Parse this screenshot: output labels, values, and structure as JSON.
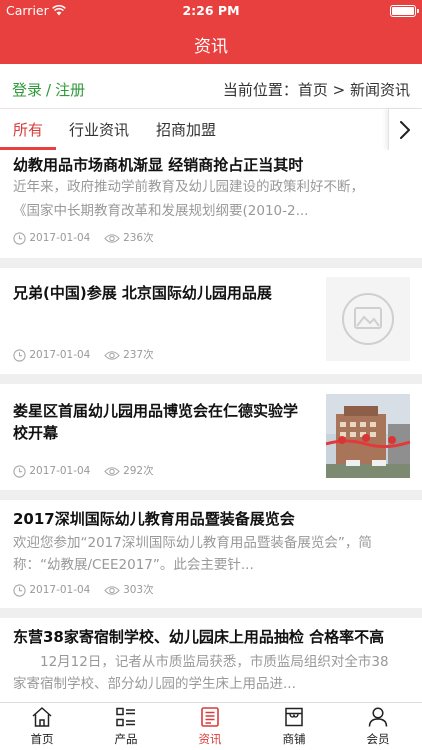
{
  "status": {
    "carrier": "Carrier",
    "time": "2:26 PM"
  },
  "nav": {
    "title": "资讯"
  },
  "subbar": {
    "login": "登录",
    "divider": "/",
    "register": "注册",
    "location": "当前位置：首页 > 新闻资讯"
  },
  "tabs": [
    {
      "label": "所有",
      "active": true
    },
    {
      "label": "行业资讯",
      "active": false
    },
    {
      "label": "招商加盟",
      "active": false
    }
  ],
  "articles": [
    {
      "title": "幼教用品市场商机渐显 经销商抢占正当其时",
      "desc1": "近年来，政府推动学前教育及幼儿园建设的政策利好不断，",
      "desc2": "《国家中长期教育改革和发展规划纲要(2010-2...",
      "date": "2017-01-04",
      "views": "236次",
      "thumb": "none"
    },
    {
      "title": "兄弟(中国)参展 北京国际幼儿园用品展",
      "date": "2017-01-04",
      "views": "237次",
      "thumb": "placeholder-image-icon"
    },
    {
      "title1": "娄星区首届幼儿园用品博览会在仁德实验学",
      "title2": "校开幕",
      "date": "2017-01-04",
      "views": "292次",
      "thumb": "building-photo"
    },
    {
      "title": "2017深圳国际幼儿教育用品暨装备展览会",
      "desc1": "欢迎您参加“2017深圳国际幼儿教育用品暨装备展览会”，简",
      "desc2": "称：“幼教展/CEE2017”。此会主要针...",
      "date": "2017-01-04",
      "views": "303次",
      "thumb": "none"
    },
    {
      "title": "东营38家寄宿制学校、幼儿园床上用品抽检 合格率不高",
      "desc1": "　　12月12日，记者从市质监局获悉，市质监局组织对全市38",
      "desc2": "家寄宿制学校、部分幼儿园的学生床上用品进...",
      "thumb": "none"
    }
  ],
  "tabbar": [
    {
      "label": "首页",
      "icon": "home-icon",
      "active": false
    },
    {
      "label": "产品",
      "icon": "product-list-icon",
      "active": false
    },
    {
      "label": "资讯",
      "icon": "news-icon",
      "active": true
    },
    {
      "label": "商铺",
      "icon": "store-icon",
      "active": false
    },
    {
      "label": "会员",
      "icon": "member-icon",
      "active": false
    }
  ],
  "colors": {
    "brand": "#e8403e",
    "link": "#2f9a3a",
    "muted": "#999999"
  }
}
